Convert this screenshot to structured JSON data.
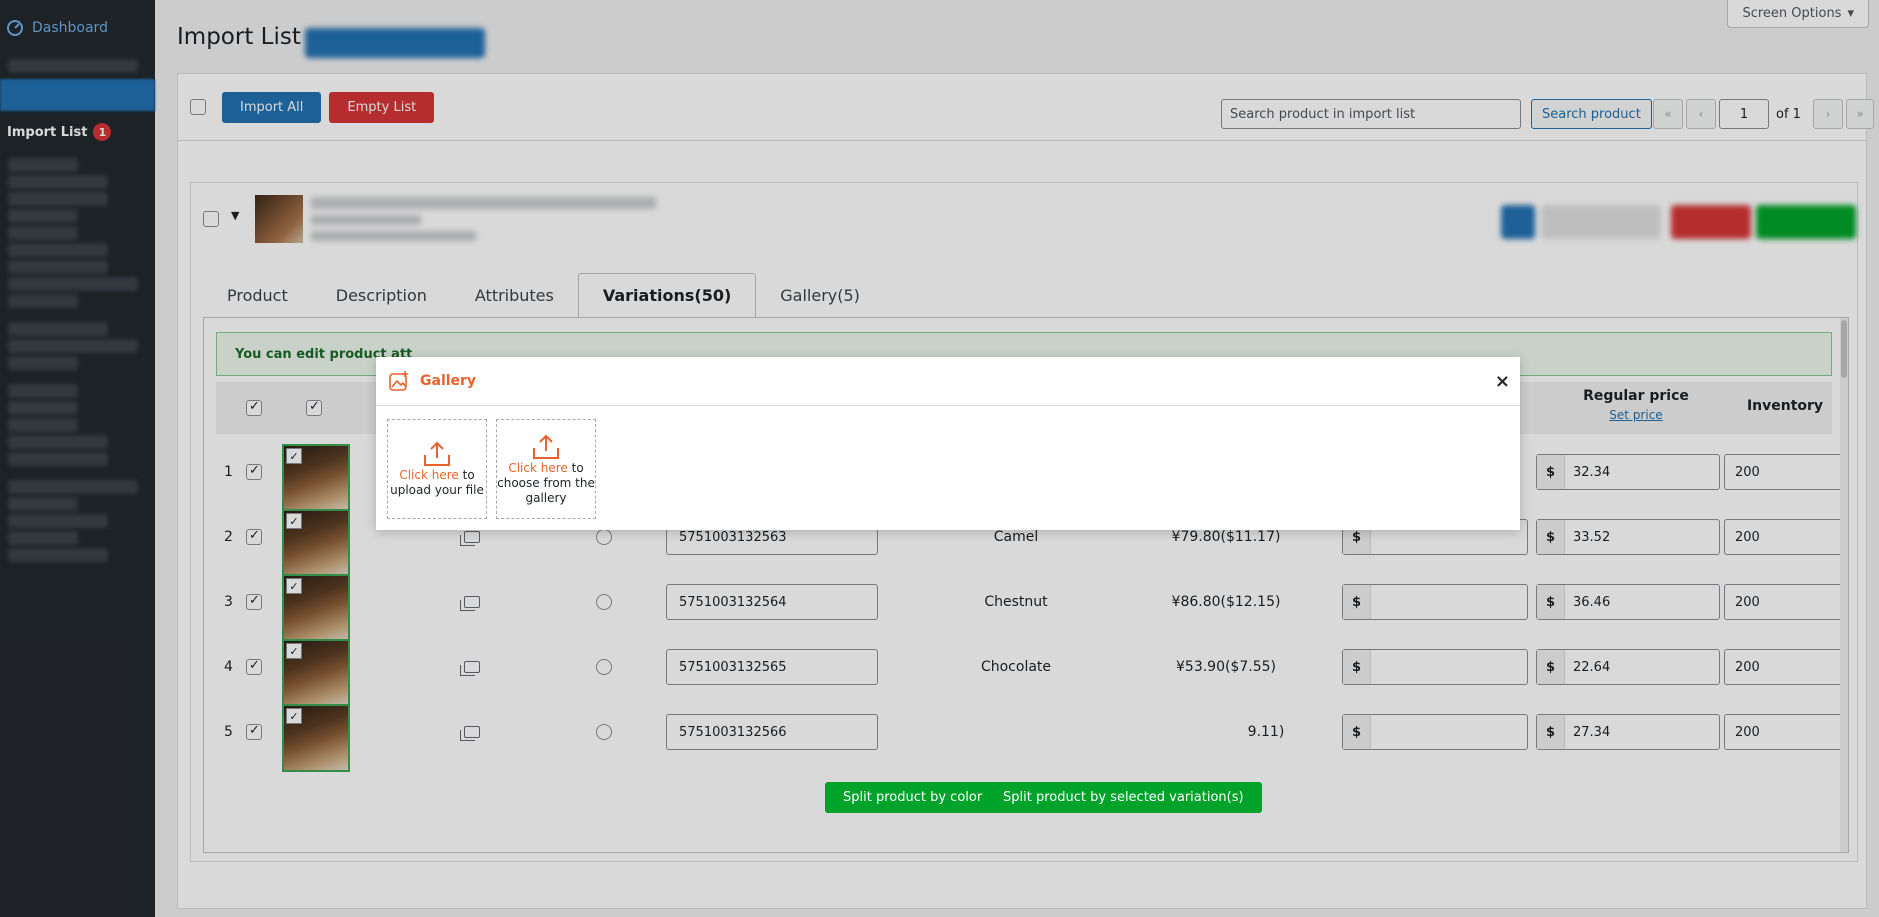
{
  "sidebar": {
    "dashboard_label": "Dashboard",
    "import_list_label": "Import List",
    "import_list_badge": "1"
  },
  "header": {
    "screen_options": "Screen Options",
    "page_title": "Import List"
  },
  "toolbar": {
    "import_all": "Import All",
    "empty_list": "Empty List",
    "search_placeholder": "Search product in import list",
    "search_button": "Search product",
    "pager": {
      "first": "«",
      "prev": "‹",
      "current": "1",
      "of_label": "of 1",
      "next": "›",
      "last": "»"
    }
  },
  "tabs": [
    {
      "label": "Product"
    },
    {
      "label": "Description"
    },
    {
      "label": "Attributes"
    },
    {
      "label": "Variations(50)"
    },
    {
      "label": "Gallery(5)"
    }
  ],
  "notice": "You can edit product att",
  "table": {
    "regular_price_header": "Regular price",
    "set_price_link": "Set price",
    "inventory_header": "Inventory",
    "currency_symbol": "$",
    "rows": [
      {
        "num": "1",
        "sku": "",
        "color": "",
        "cost": "",
        "sale": "",
        "regular": "32.34",
        "inventory": "200"
      },
      {
        "num": "2",
        "sku": "5751003132563",
        "color": "Camel",
        "cost": "¥79.80($11.17)",
        "sale": "",
        "regular": "33.52",
        "inventory": "200"
      },
      {
        "num": "3",
        "sku": "5751003132564",
        "color": "Chestnut",
        "cost": "¥86.80($12.15)",
        "sale": "",
        "regular": "36.46",
        "inventory": "200"
      },
      {
        "num": "4",
        "sku": "5751003132565",
        "color": "Chocolate",
        "cost": "¥53.90($7.55)",
        "sale": "",
        "regular": "22.64",
        "inventory": "200"
      },
      {
        "num": "5",
        "sku": "5751003132566",
        "color": "",
        "cost": "9.11)",
        "sale": "",
        "regular": "27.34",
        "inventory": "200"
      }
    ]
  },
  "split": {
    "by_color": "Split product by color",
    "by_selected": "Split product by selected variation(s)"
  },
  "modal": {
    "title": "Gallery",
    "close": "×",
    "upload_link": "Click here",
    "upload_text": "to upload your file",
    "choose_link": "Click here",
    "choose_text": "to choose from the gallery"
  },
  "colors": {
    "accent_blue": "#2271b1",
    "danger_red": "#d63638",
    "success_green": "#00a32a",
    "modal_orange": "#e8632b"
  }
}
